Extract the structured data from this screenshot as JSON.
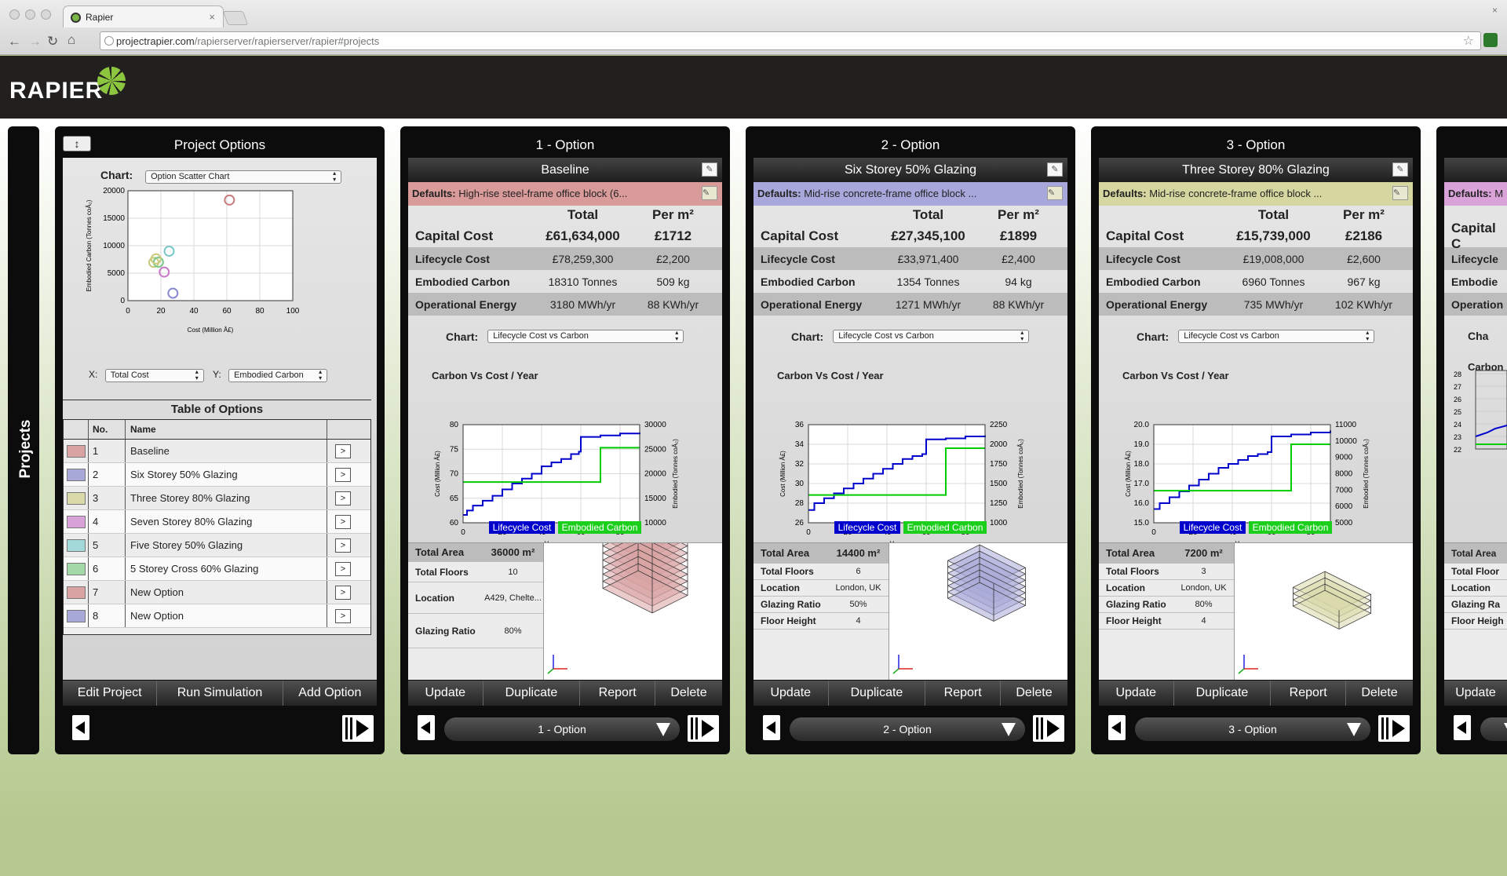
{
  "browser": {
    "tab_title": "Rapier",
    "url_host": "projectrapier.com",
    "url_path": "/rapierserver/rapierserver/rapier#projects"
  },
  "app": {
    "logo_text": "RAPIER"
  },
  "sidebar": {
    "label": "Projects"
  },
  "project_options": {
    "title": "Project Options",
    "chart_label": "Chart:",
    "chart_select": "Option Scatter Chart",
    "x_label": "X:",
    "x_select": "Total Cost",
    "y_label": "Y:",
    "y_select": "Embodied Carbon",
    "table_title": "Table of Options",
    "col_no": "No.",
    "col_name": "Name",
    "rows": [
      {
        "no": "1",
        "name": "Baseline",
        "color": "#d9a3a3"
      },
      {
        "no": "2",
        "name": "Six Storey 50% Glazing",
        "color": "#a9a9d9"
      },
      {
        "no": "3",
        "name": "Three Storey 80% Glazing",
        "color": "#d9d9a9"
      },
      {
        "no": "4",
        "name": "Seven Storey 80% Glazing",
        "color": "#d9a3d9"
      },
      {
        "no": "5",
        "name": "Five Storey 50% Glazing",
        "color": "#a3d9d9"
      },
      {
        "no": "6",
        "name": "5 Storey Cross 60% Glazing",
        "color": "#a3d9a9"
      },
      {
        "no": "7",
        "name": "New Option",
        "color": "#d9a3a3"
      },
      {
        "no": "8",
        "name": "New Option",
        "color": "#a9a9d9"
      }
    ],
    "go_label": ">",
    "actions": [
      "Edit Project",
      "Run Simulation",
      "Add Option"
    ]
  },
  "scatter": {
    "xlabel": "Cost (Million Â£)",
    "ylabel": "Embodied Carbon (Tonnes coÂ₂)",
    "xticks": [
      "0",
      "20",
      "40",
      "60",
      "80",
      "100"
    ],
    "yticks": [
      "0",
      "5000",
      "10000",
      "15000",
      "20000"
    ]
  },
  "chart_data": [
    {
      "type": "scatter",
      "xlabel": "Cost (Million Â£)",
      "ylabel": "Embodied Carbon (Tonnes coÂ₂)",
      "xlim": [
        0,
        100
      ],
      "ylim": [
        0,
        20000
      ],
      "points": [
        {
          "x": 61.6,
          "y": 18310,
          "color": "#c97b7b"
        },
        {
          "x": 27.3,
          "y": 1354,
          "color": "#8a8ad0"
        },
        {
          "x": 15.7,
          "y": 6960,
          "color": "#c8c87a"
        },
        {
          "x": 22.0,
          "y": 5200,
          "color": "#c97bc9"
        },
        {
          "x": 25.0,
          "y": 9000,
          "color": "#7bc9c9"
        },
        {
          "x": 18.5,
          "y": 7000,
          "color": "#7bc98a"
        },
        {
          "x": 17.0,
          "y": 7600,
          "color": "#c9c97b"
        }
      ]
    },
    {
      "type": "line",
      "title": "Carbon Vs Cost / Year",
      "xlabel": "Year",
      "ylabel": "Cost (Million Â£)",
      "ylabel2": "Embodied (Tonnes coÂ₂)",
      "xlim": [
        0,
        90
      ],
      "ylim": [
        60,
        80
      ],
      "ylim2": [
        10000,
        30000
      ],
      "xticks": [
        "0",
        "20",
        "40",
        "60",
        "80"
      ],
      "yticks": [
        "60",
        "65",
        "70",
        "75",
        "80"
      ],
      "yticks2": [
        "10000",
        "15000",
        "20000",
        "25000",
        "30000"
      ],
      "series": [
        {
          "name": "Lifecycle Cost",
          "axis": "left",
          "points": [
            [
              0,
              61.6
            ],
            [
              2,
              62.5
            ],
            [
              5,
              63.5
            ],
            [
              10,
              64.5
            ],
            [
              15,
              65.5
            ],
            [
              20,
              66.8
            ],
            [
              25,
              68
            ],
            [
              30,
              69
            ],
            [
              35,
              70
            ],
            [
              40,
              71.5
            ],
            [
              45,
              72.3
            ],
            [
              50,
              73
            ],
            [
              55,
              74
            ],
            [
              59,
              74.5
            ],
            [
              60,
              77.5
            ],
            [
              70,
              77.8
            ],
            [
              80,
              78.2
            ],
            [
              90,
              78.4
            ]
          ]
        },
        {
          "name": "Embodied Carbon",
          "axis": "right",
          "points": [
            [
              0,
              18310
            ],
            [
              70,
              18310
            ],
            [
              70,
              25300
            ],
            [
              90,
              25300
            ]
          ]
        }
      ]
    },
    {
      "type": "line",
      "title": "Carbon Vs Cost / Year",
      "xlabel": "Year",
      "ylabel": "Cost (Million Â£)",
      "ylabel2": "Embodied (Tonnes coÂ₂)",
      "xlim": [
        0,
        90
      ],
      "ylim": [
        26,
        36
      ],
      "ylim2": [
        1000,
        2250
      ],
      "xticks": [
        "0",
        "20",
        "40",
        "60",
        "80"
      ],
      "yticks": [
        "26",
        "28",
        "30",
        "32",
        "34",
        "36"
      ],
      "yticks2": [
        "1000",
        "1250",
        "1500",
        "1750",
        "2000",
        "2250"
      ],
      "series": [
        {
          "name": "Lifecycle Cost",
          "axis": "left",
          "points": [
            [
              0,
              27.3
            ],
            [
              3,
              28
            ],
            [
              8,
              28.5
            ],
            [
              13,
              29
            ],
            [
              18,
              29.5
            ],
            [
              23,
              30
            ],
            [
              28,
              30.5
            ],
            [
              33,
              31
            ],
            [
              38,
              31.5
            ],
            [
              43,
              32
            ],
            [
              48,
              32.5
            ],
            [
              53,
              32.8
            ],
            [
              58,
              33
            ],
            [
              60,
              34.5
            ],
            [
              70,
              34.6
            ],
            [
              80,
              34.8
            ],
            [
              90,
              34.9
            ]
          ]
        },
        {
          "name": "Embodied Carbon",
          "axis": "right",
          "points": [
            [
              0,
              1354
            ],
            [
              70,
              1354
            ],
            [
              70,
              1950
            ],
            [
              90,
              1950
            ]
          ]
        }
      ]
    },
    {
      "type": "line",
      "title": "Carbon Vs Cost / Year",
      "xlabel": "Year",
      "ylabel": "Cost (Million Â£)",
      "ylabel2": "Embodied (Tonnes coÂ₂)",
      "xlim": [
        0,
        90
      ],
      "ylim": [
        15,
        20
      ],
      "ylim2": [
        5000,
        11000
      ],
      "xticks": [
        "0",
        "20",
        "40",
        "60",
        "80"
      ],
      "yticks": [
        "15.0",
        "16.0",
        "17.0",
        "18.0",
        "19.0",
        "20.0"
      ],
      "yticks2": [
        "5000",
        "6000",
        "7000",
        "8000",
        "9000",
        "10000",
        "11000"
      ],
      "series": [
        {
          "name": "Lifecycle Cost",
          "axis": "left",
          "points": [
            [
              0,
              15.7
            ],
            [
              3,
              16
            ],
            [
              8,
              16.3
            ],
            [
              13,
              16.6
            ],
            [
              18,
              16.9
            ],
            [
              23,
              17.2
            ],
            [
              28,
              17.5
            ],
            [
              33,
              17.8
            ],
            [
              38,
              18
            ],
            [
              43,
              18.2
            ],
            [
              48,
              18.4
            ],
            [
              53,
              18.5
            ],
            [
              58,
              18.6
            ],
            [
              60,
              19.4
            ],
            [
              70,
              19.5
            ],
            [
              80,
              19.6
            ],
            [
              90,
              19.7
            ]
          ]
        },
        {
          "name": "Embodied Carbon",
          "axis": "right",
          "points": [
            [
              0,
              6960
            ],
            [
              70,
              6960
            ],
            [
              70,
              9800
            ],
            [
              90,
              9800
            ]
          ]
        }
      ]
    }
  ],
  "options": [
    {
      "title": "1 - Option",
      "name": "Baseline",
      "color": "#d9a3a3",
      "defaults_bg": "#d99a9a",
      "defaults_label": "Defaults:",
      "defaults_text": "High-rise steel-frame office block (6...",
      "hdr_total": "Total",
      "hdr_per": "Per m²",
      "capital_label": "Capital Cost",
      "capital_total": "£61,634,000",
      "capital_per": "£1712",
      "lifecycle_label": "Lifecycle Cost",
      "lifecycle_total": "£78,259,300",
      "lifecycle_per": "£2,200",
      "embodied_label": "Embodied Carbon",
      "embodied_total": "18310 Tonnes",
      "embodied_per": "509 kg",
      "operational_label": "Operational Energy",
      "operational_total": "3180 MWh/yr",
      "operational_per": "88 KWh/yr",
      "chart_label": "Chart:",
      "chart_select": "Lifecycle Cost vs Carbon",
      "chart_title": "Carbon Vs Cost / Year",
      "legend_cost": "Lifecycle Cost",
      "legend_carbon": "Embodied Carbon",
      "stats": [
        {
          "k": "Total Area",
          "v": "36000 m²"
        },
        {
          "k": "Total Floors",
          "v": "10"
        },
        {
          "k": "Location",
          "v": "A429, Chelte..."
        },
        {
          "k": "Glazing Ratio",
          "v": "80%"
        }
      ],
      "floors": 10,
      "footprint": "large",
      "actions": [
        "Update",
        "Duplicate",
        "Report",
        "Delete"
      ],
      "nav_select": "1 - Option"
    },
    {
      "title": "2 - Option",
      "name": "Six Storey 50% Glazing",
      "color": "#a9a9d9",
      "defaults_bg": "#a7a7dc",
      "defaults_label": "Defaults:",
      "defaults_text": "Mid-rise concrete-frame office block ...",
      "hdr_total": "Total",
      "hdr_per": "Per m²",
      "capital_label": "Capital Cost",
      "capital_total": "£27,345,100",
      "capital_per": "£1899",
      "lifecycle_label": "Lifecycle Cost",
      "lifecycle_total": "£33,971,400",
      "lifecycle_per": "£2,400",
      "embodied_label": "Embodied Carbon",
      "embodied_total": "1354 Tonnes",
      "embodied_per": "94 kg",
      "operational_label": "Operational Energy",
      "operational_total": "1271 MWh/yr",
      "operational_per": "88 KWh/yr",
      "chart_label": "Chart:",
      "chart_select": "Lifecycle Cost vs Carbon",
      "chart_title": "Carbon Vs Cost / Year",
      "legend_cost": "Lifecycle Cost",
      "legend_carbon": "Embodied Carbon",
      "stats": [
        {
          "k": "Total Area",
          "v": "14400 m²"
        },
        {
          "k": "Total Floors",
          "v": "6"
        },
        {
          "k": "Location",
          "v": "London, UK"
        },
        {
          "k": "Glazing Ratio",
          "v": "50%"
        },
        {
          "k": "Floor Height",
          "v": "4"
        }
      ],
      "floors": 6,
      "footprint": "medium",
      "actions": [
        "Update",
        "Duplicate",
        "Report",
        "Delete"
      ],
      "nav_select": "2 - Option"
    },
    {
      "title": "3 - Option",
      "name": "Three Storey 80% Glazing",
      "color": "#d9d9a9",
      "defaults_bg": "#d6d6a0",
      "defaults_label": "Defaults:",
      "defaults_text": "Mid-rise concrete-frame office block ...",
      "hdr_total": "Total",
      "hdr_per": "Per m²",
      "capital_label": "Capital Cost",
      "capital_total": "£15,739,000",
      "capital_per": "£2186",
      "lifecycle_label": "Lifecycle Cost",
      "lifecycle_total": "£19,008,000",
      "lifecycle_per": "£2,600",
      "embodied_label": "Embodied Carbon",
      "embodied_total": "6960 Tonnes",
      "embodied_per": "967 kg",
      "operational_label": "Operational Energy",
      "operational_total": "735 MWh/yr",
      "operational_per": "102 KWh/yr",
      "chart_label": "Chart:",
      "chart_select": "Lifecycle Cost vs Carbon",
      "chart_title": "Carbon Vs Cost / Year",
      "legend_cost": "Lifecycle Cost",
      "legend_carbon": "Embodied Carbon",
      "stats": [
        {
          "k": "Total Area",
          "v": "7200 m²"
        },
        {
          "k": "Total Floors",
          "v": "3"
        },
        {
          "k": "Location",
          "v": "London, UK"
        },
        {
          "k": "Glazing Ratio",
          "v": "80%"
        },
        {
          "k": "Floor Height",
          "v": "4"
        }
      ],
      "floors": 3,
      "footprint": "flat",
      "actions": [
        "Update",
        "Duplicate",
        "Report",
        "Delete"
      ],
      "nav_select": "3 - Option"
    }
  ],
  "partial_option": {
    "defaults_label": "Defaults:",
    "defaults_text": "M",
    "defaults_bg": "#d9a3d9",
    "capital_label": "Capital C",
    "lifecycle_label": "Lifecycle",
    "embodied_label": "Embodie",
    "operational_label": "Operation",
    "chart_label": "Cha",
    "chart_title": "Carbon",
    "yticks": [
      "28",
      "27",
      "26",
      "25",
      "24",
      "23",
      "22"
    ],
    "stats": [
      "Total Area",
      "Total Floor",
      "Location",
      "Glazing Ra",
      "Floor Heigh"
    ],
    "action": "Update"
  },
  "colors": {
    "cost_line": "#0000cc",
    "carbon_line": "#00cc00"
  }
}
